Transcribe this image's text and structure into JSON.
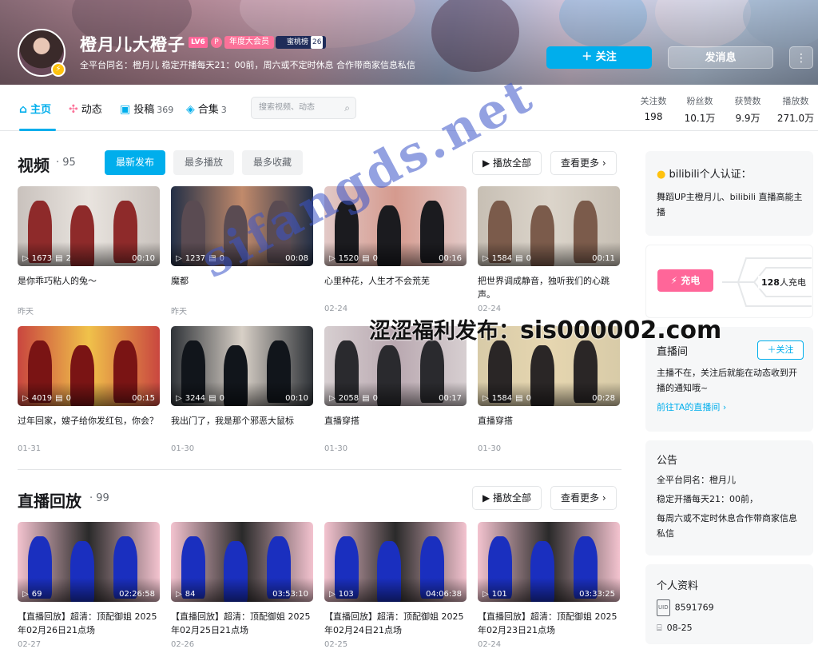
{
  "header": {
    "username": "橙月儿大橙子",
    "level": "LV6",
    "vip_mark": "P",
    "tag_annual": "年度大会员",
    "tag_rank": "蜜桃榜",
    "rank_num": "26",
    "sign": "全平台同名：橙月儿 稳定开播每天21：00前，周六或不定时休息 合作带商家信息私信",
    "follow_btn": "＋ 关注",
    "message_btn": "发消息",
    "more_btn": "⋮"
  },
  "nav": {
    "home": "主页",
    "dynamic": "动态",
    "posts": "投稿",
    "posts_count": "369",
    "collections": "合集",
    "collections_count": "3",
    "search_placeholder": "搜索视频、动态"
  },
  "stats": [
    {
      "label": "关注数",
      "value": "198"
    },
    {
      "label": "粉丝数",
      "value": "10.1万"
    },
    {
      "label": "获赞数",
      "value": "9.9万"
    },
    {
      "label": "播放数",
      "value": "271.0万"
    }
  ],
  "videos": {
    "title": "视频",
    "count": "· 95",
    "tabs": [
      "最新发布",
      "最多播放",
      "最多收藏"
    ],
    "play_all": "▶ 播放全部",
    "see_more": "查看更多 ›",
    "items": [
      {
        "plays": "1673",
        "danmaku": "2",
        "duration": "00:10",
        "title": "是你乖巧粘人的兔～",
        "date": "昨天"
      },
      {
        "plays": "1237",
        "danmaku": "0",
        "duration": "00:08",
        "title": "魔都",
        "date": "昨天"
      },
      {
        "plays": "1520",
        "danmaku": "0",
        "duration": "00:16",
        "title": "心里种花，人生才不会荒芜",
        "date": "02-24"
      },
      {
        "plays": "1584",
        "danmaku": "0",
        "duration": "00:11",
        "title": "把世界调成静音，独听我们的心跳声。",
        "date": "02-24"
      },
      {
        "plays": "4019",
        "danmaku": "0",
        "duration": "00:15",
        "title": "过年回家，嫂子给你发红包，你会？",
        "date": "01-31"
      },
      {
        "plays": "3244",
        "danmaku": "0",
        "duration": "00:10",
        "title": "我出门了，我是那个邪恶大鼠标",
        "date": "01-30"
      },
      {
        "plays": "2058",
        "danmaku": "0",
        "duration": "00:17",
        "title": "直播穿搭",
        "date": "01-30"
      },
      {
        "plays": "1584",
        "danmaku": "0",
        "duration": "00:28",
        "title": "直播穿搭",
        "date": "01-30"
      }
    ]
  },
  "replays": {
    "title": "直播回放",
    "count": "· 99",
    "play_all": "▶ 播放全部",
    "see_more": "查看更多 ›",
    "items": [
      {
        "plays": "69",
        "duration": "02:26:58",
        "title": "【直播回放】超清：顶配御姐 2025年02月26日21点场",
        "date": "02-27"
      },
      {
        "plays": "84",
        "duration": "03:53:10",
        "title": "【直播回放】超清：顶配御姐 2025年02月25日21点场",
        "date": "02-26"
      },
      {
        "plays": "103",
        "duration": "04:06:38",
        "title": "【直播回放】超清：顶配御姐 2025年02月24日21点场",
        "date": "02-25"
      },
      {
        "plays": "101",
        "duration": "03:33:25",
        "title": "【直播回放】超清：顶配御姐 2025年02月23日21点场",
        "date": "02-24"
      }
    ]
  },
  "sidebar": {
    "cert_title": "bilibili个人认证：",
    "cert_text": "舞蹈UP主橙月儿、bilibili 直播高能主播",
    "charge_btn": "充电",
    "charge_count": "128",
    "charge_suffix": "人充电",
    "live_title": "直播间",
    "live_follow": "＋关注",
    "live_text": "主播不在，关注后就能在动态收到开播的通知哦~",
    "live_link": "前往TA的直播间 ›",
    "notice_title": "公告",
    "notice_lines": [
      "全平台同名：橙月儿",
      "稳定开播每天21：00前，",
      "每周六或不定时休息合作带商家信息私信"
    ],
    "profile_title": "个人资料",
    "uid": "8591769",
    "birthday": "08-25"
  },
  "watermark": {
    "site": "sifangds.net",
    "text_cn": "涩涩福利发布：",
    "text_url": "sis000002.com"
  },
  "colors": {
    "accent": "#00aeec",
    "pink": "#ff6699"
  }
}
